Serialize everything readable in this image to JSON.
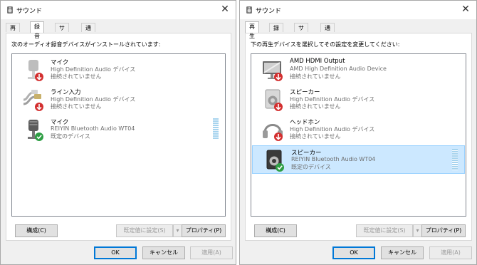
{
  "dialogs": [
    {
      "title": "サウンド",
      "tabs": [
        "再生",
        "録音",
        "サウンド",
        "通信"
      ],
      "active_tab": 1,
      "instruction": "次のオーディオ録音デバイスがインストールされています:",
      "devices": [
        {
          "name": "マイク",
          "driver": "High Definition Audio デバイス",
          "status": "接続されていません",
          "icon": "microphone-icon",
          "badge": "disconnected",
          "selected": false,
          "level_meter": false
        },
        {
          "name": "ライン入力",
          "driver": "High Definition Audio デバイス",
          "status": "接続されていません",
          "icon": "line-in-cable-icon",
          "badge": "disconnected",
          "selected": false,
          "level_meter": false
        },
        {
          "name": "マイク",
          "driver": "REIYIN Bluetooth Audio WT04",
          "status": "既定のデバイス",
          "icon": "microphone-icon",
          "badge": "default",
          "selected": false,
          "level_meter": true
        }
      ],
      "buttons": {
        "configure": "構成(C)",
        "set_default": "既定値に設定(S)",
        "properties": "プロパティ(P)",
        "ok": "OK",
        "cancel": "キャンセル",
        "apply": "適用(A)"
      }
    },
    {
      "title": "サウンド",
      "tabs": [
        "再生",
        "録音",
        "サウンド",
        "通信"
      ],
      "active_tab": 0,
      "instruction": "下の再生デバイスを選択してその設定を変更してください:",
      "devices": [
        {
          "name": "AMD HDMI Output",
          "driver": "AMD High Definition Audio Device",
          "status": "接続されていません",
          "icon": "monitor-icon",
          "badge": "disconnected",
          "selected": false,
          "level_meter": false
        },
        {
          "name": "スピーカー",
          "driver": "High Definition Audio デバイス",
          "status": "接続されていません",
          "icon": "speaker-icon",
          "badge": "disconnected",
          "selected": false,
          "level_meter": false
        },
        {
          "name": "ヘッドホン",
          "driver": "High Definition Audio デバイス",
          "status": "接続されていません",
          "icon": "headphones-icon",
          "badge": "disconnected",
          "selected": false,
          "level_meter": false
        },
        {
          "name": "スピーカー",
          "driver": "REIYIN Bluetooth Audio WT04",
          "status": "既定のデバイス",
          "icon": "speaker-icon",
          "badge": "default",
          "selected": true,
          "level_meter": true
        }
      ],
      "buttons": {
        "configure": "構成(C)",
        "set_default": "既定値に設定(S)",
        "properties": "プロパティ(P)",
        "ok": "OK",
        "cancel": "キャンセル",
        "apply": "適用(A)"
      }
    }
  ],
  "colors": {
    "selected_bg": "#cce8ff",
    "disconnected_badge": "#d32f2f",
    "default_badge": "#2e9e44",
    "level_meter": "#a6d3ee"
  }
}
